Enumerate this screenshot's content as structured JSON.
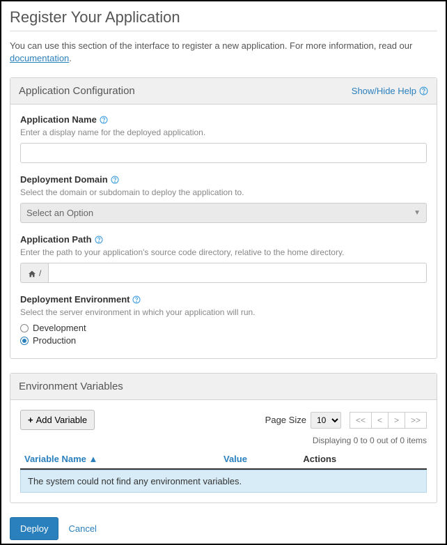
{
  "page": {
    "title": "Register Your Application",
    "intro_text": "You can use this section of the interface to register a new application. For more information, read our ",
    "intro_link": "documentation",
    "intro_end": "."
  },
  "config_panel": {
    "title": "Application Configuration",
    "help_link": "Show/Hide Help",
    "fields": {
      "app_name": {
        "label": "Application Name",
        "hint": "Enter a display name for the deployed application.",
        "value": ""
      },
      "domain": {
        "label": "Deployment Domain",
        "hint": "Select the domain or subdomain to deploy the application to.",
        "placeholder": "Select an Option"
      },
      "app_path": {
        "label": "Application Path",
        "hint": "Enter the path to your application's source code directory, relative to the home directory.",
        "addon_suffix": "/",
        "value": ""
      },
      "env": {
        "label": "Deployment Environment",
        "hint": "Select the server environment in which your application will run.",
        "options": {
          "dev": "Development",
          "prod": "Production"
        },
        "selected": "prod"
      }
    }
  },
  "env_panel": {
    "title": "Environment Variables",
    "add_button": "Add Variable",
    "page_size_label": "Page Size",
    "page_size_value": "10",
    "pager": {
      "first": "<<",
      "prev": "<",
      "next": ">",
      "last": ">>"
    },
    "display_info": "Displaying 0 to 0 out of 0 items",
    "columns": {
      "name": "Variable Name",
      "sort_indicator": "▲",
      "value": "Value",
      "actions": "Actions"
    },
    "empty_message": "The system could not find any environment variables."
  },
  "footer": {
    "deploy": "Deploy",
    "cancel": "Cancel"
  }
}
